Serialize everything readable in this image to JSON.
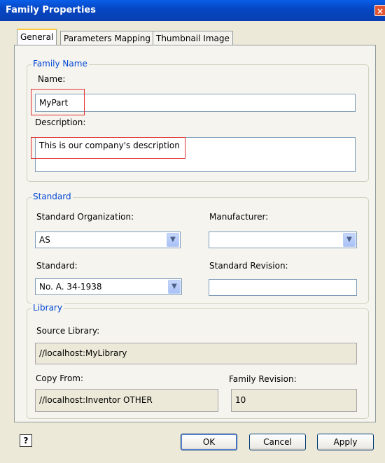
{
  "window": {
    "title": "Family Properties",
    "close_glyph": "×"
  },
  "tabs": [
    {
      "label": "General",
      "active": true
    },
    {
      "label": "Parameters Mapping",
      "active": false
    },
    {
      "label": "Thumbnail Image",
      "active": false
    }
  ],
  "family_name": {
    "legend": "Family Name",
    "name_label": "Name:",
    "name_value": "MyPart",
    "description_label": "Description:",
    "description_value": "This is our company's description"
  },
  "standard": {
    "legend": "Standard",
    "organization_label": "Standard Organization:",
    "organization_value": "AS",
    "manufacturer_label": "Manufacturer:",
    "manufacturer_value": "",
    "standard_label": "Standard:",
    "standard_value": "No. A. 34-1938",
    "revision_label": "Standard Revision:",
    "revision_value": ""
  },
  "library": {
    "legend": "Library",
    "source_label": "Source Library:",
    "source_value": "//localhost:MyLibrary",
    "copy_from_label": "Copy From:",
    "copy_from_value": "//localhost:Inventor OTHER",
    "family_revision_label": "Family Revision:",
    "family_revision_value": "10"
  },
  "buttons": {
    "help": "?",
    "ok": "OK",
    "cancel": "Cancel",
    "apply": "Apply"
  },
  "colors": {
    "title_bar": "#0a5ee8",
    "group_legend": "#0046d5",
    "annotation": "#e03030"
  },
  "icons": {
    "dropdown": "chevron-down-icon",
    "help": "help-icon",
    "close": "close-icon"
  }
}
